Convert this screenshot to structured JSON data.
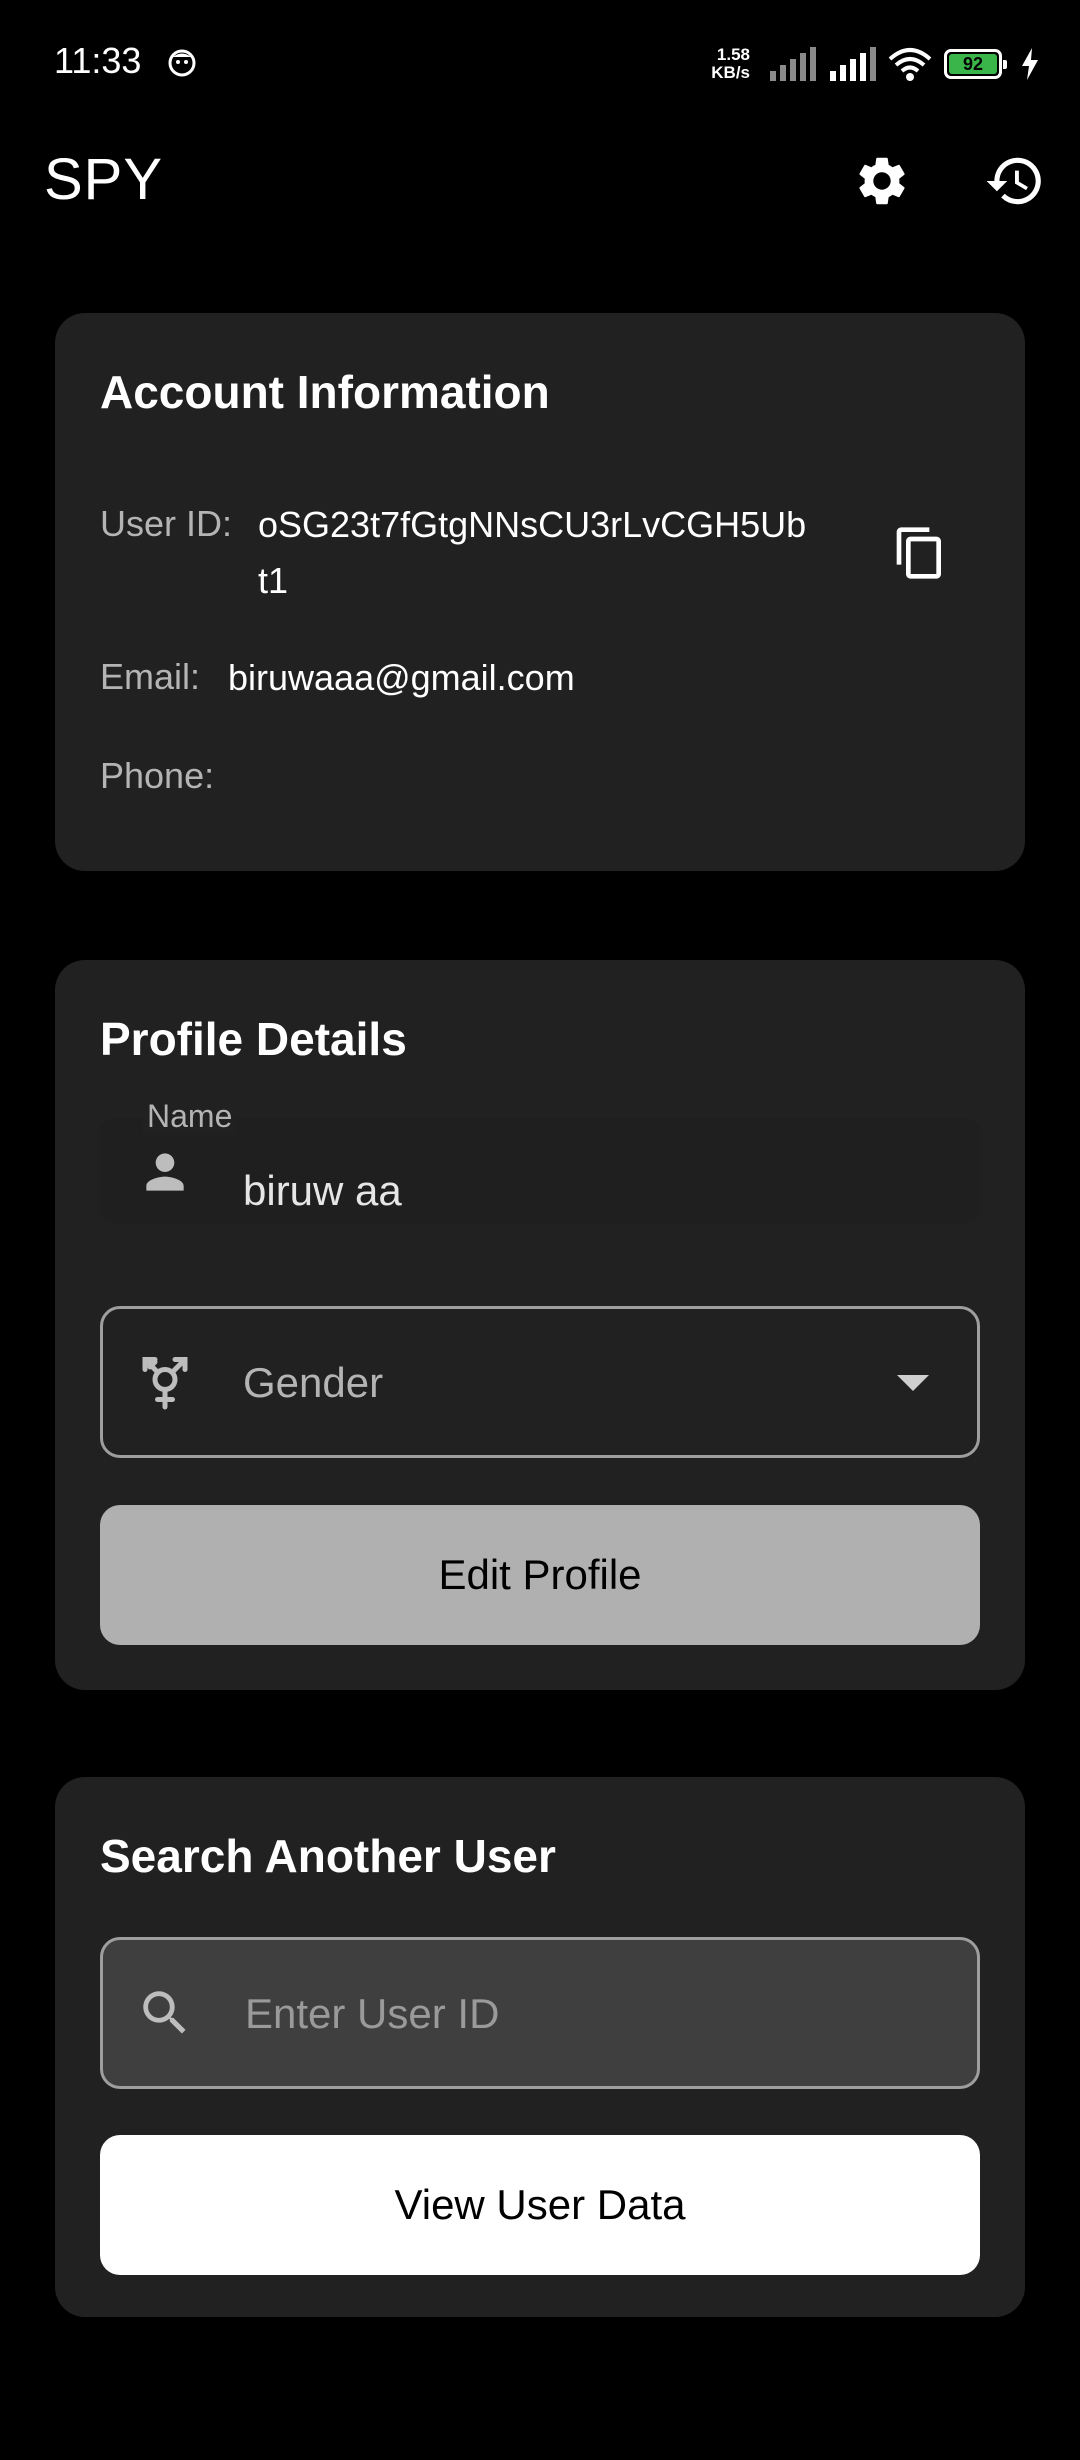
{
  "status_bar": {
    "time": "11:33",
    "net_speed_value": "1.58",
    "net_speed_unit": "KB/s",
    "battery_level": "92"
  },
  "app_bar": {
    "title": "SPY",
    "settings_icon": "gear-icon",
    "history_icon": "history-icon"
  },
  "account": {
    "title": "Account Information",
    "user_id_label": "User ID:",
    "user_id_line1": "oSG23t7fGtgNNsCU3rLvCGH5Ub",
    "user_id_line2": "t1",
    "email_label": "Email:",
    "email_value": "biruwaaa@gmail.com",
    "phone_label": "Phone:",
    "phone_value": ""
  },
  "profile": {
    "title": "Profile Details",
    "name_label": "Name",
    "name_value": "biruw aa",
    "gender_placeholder": "Gender",
    "edit_button": "Edit Profile"
  },
  "search": {
    "title": "Search Another User",
    "placeholder": "Enter User ID",
    "value": "",
    "view_button": "View User Data"
  },
  "colors": {
    "background": "#000000",
    "card": "#212121",
    "battery": "#39b54a",
    "edit_button": "#b0b0b0",
    "view_button": "#ffffff"
  }
}
